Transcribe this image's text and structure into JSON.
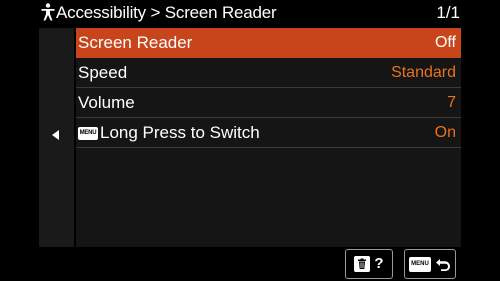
{
  "header": {
    "title": "Accessibility > Screen Reader",
    "page": "1/1",
    "icon": "accessibility-person-icon"
  },
  "menu": {
    "items": [
      {
        "label": "Screen Reader",
        "value": "Off",
        "selected": true
      },
      {
        "label": "Speed",
        "value": "Standard",
        "selected": false
      },
      {
        "label": "Volume",
        "value": "7",
        "selected": false
      },
      {
        "label": "Long Press to Switch",
        "value": "On",
        "selected": false,
        "badge": "MENU"
      }
    ]
  },
  "footer": {
    "help_icons": [
      "trash-icon",
      "question-icon"
    ],
    "help_text": "?",
    "back_badge": "MENU",
    "back_icon": "return-arrow-icon"
  },
  "colors": {
    "selected_row": "#c8451c",
    "value_text": "#e8721c",
    "background": "#000000"
  }
}
